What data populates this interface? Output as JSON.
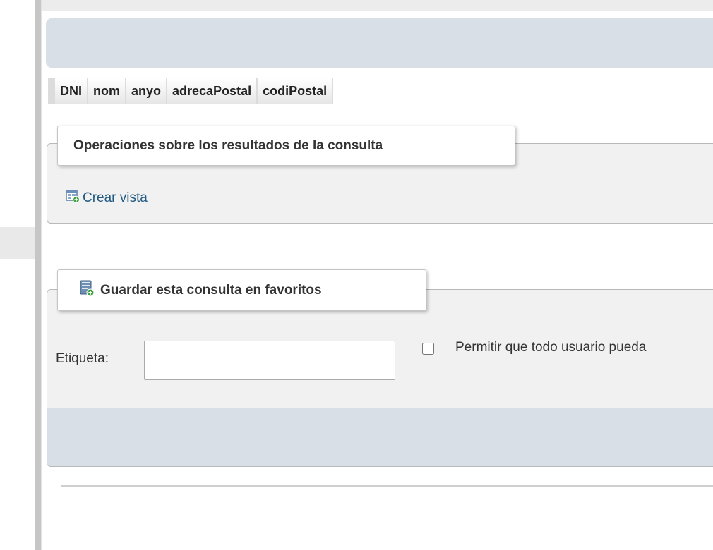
{
  "results_table": {
    "columns": [
      "DNI",
      "nom",
      "anyo",
      "adrecaPostal",
      "codiPostal"
    ]
  },
  "query_operations": {
    "legend": "Operaciones sobre los resultados de la consulta",
    "create_view_label": "Crear vista",
    "create_view_icon": "create-view-icon"
  },
  "bookmark": {
    "legend": "Guardar esta consulta en favoritos",
    "legend_icon": "bookmark-add-icon",
    "label_caption": "Etiqueta:",
    "label_value": "",
    "share_label": "Permitir que todo usuario pueda",
    "share_checked": false
  },
  "colors": {
    "bar_blue": "#d9dfe6",
    "panel_bg": "#f1f1f1",
    "link": "#235a81"
  }
}
